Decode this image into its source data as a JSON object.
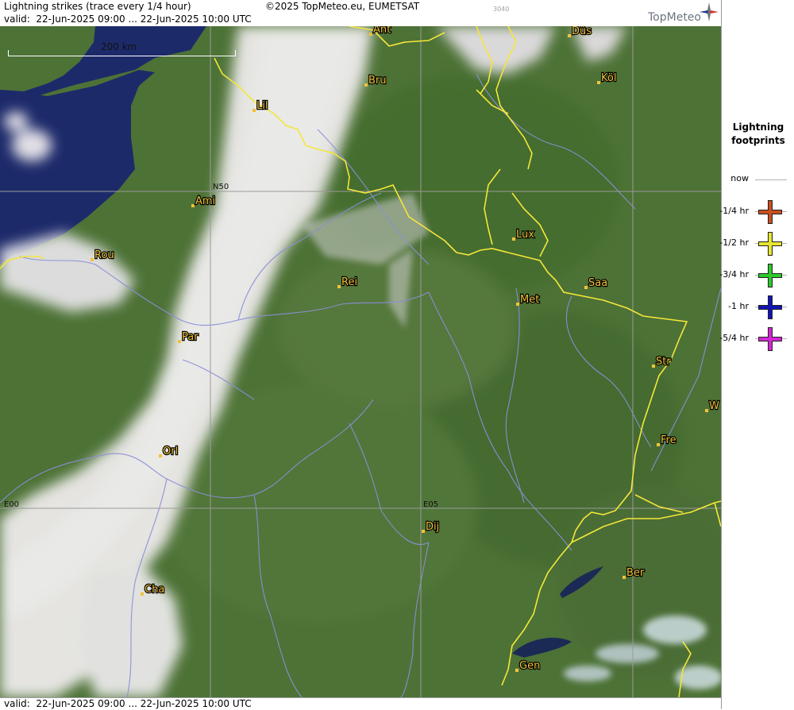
{
  "header": {
    "title": "Lightning strikes (trace every 1/4 hour)",
    "valid": "valid:  22-Jun-2025 09:00 ... 22-Jun-2025 10:00 UTC",
    "copyright": "©2025 TopMeteo.eu, EUMETSAT",
    "code": "3040",
    "brand": "TopMeteo"
  },
  "footer": {
    "valid": "valid:  22-Jun-2025 09:00 ... 22-Jun-2025 10:00 UTC"
  },
  "map": {
    "scale_label": "200 km",
    "grid_labels": {
      "lat": "N50",
      "lon_west": "E00",
      "lon_east": "E05"
    },
    "cities": [
      {
        "name": "Ant"
      },
      {
        "name": "Düs"
      },
      {
        "name": "Bru"
      },
      {
        "name": "Köl"
      },
      {
        "name": "Lil"
      },
      {
        "name": "Ami"
      },
      {
        "name": "Lux"
      },
      {
        "name": "Rou"
      },
      {
        "name": "Rei"
      },
      {
        "name": "Saa"
      },
      {
        "name": "Met"
      },
      {
        "name": "Par"
      },
      {
        "name": "Str"
      },
      {
        "name": "W"
      },
      {
        "name": "Fre"
      },
      {
        "name": "Orl"
      },
      {
        "name": "Dij"
      },
      {
        "name": "Ber"
      },
      {
        "name": "Cha"
      },
      {
        "name": "Gen"
      }
    ],
    "colors": {
      "land": "#4d7236",
      "sea": "#1d2a6a",
      "border": "#f5e63a",
      "river": "#8a8fd8",
      "city_dot": "#f0c23a",
      "grid": "#9a9a9a",
      "cloud": "#f2eef0"
    }
  },
  "legend": {
    "title_line1": "Lightning",
    "title_line2": "footprints",
    "items": [
      {
        "label": "now",
        "color": ""
      },
      {
        "label": "-1/4 hr",
        "color": "#c8501e"
      },
      {
        "label": "-1/2 hr",
        "color": "#e6e632"
      },
      {
        "label": "-3/4 hr",
        "color": "#2ec82e"
      },
      {
        "label": "-1 hr",
        "color": "#1414b4"
      },
      {
        "label": "-5/4 hr",
        "color": "#d228d2"
      }
    ]
  }
}
